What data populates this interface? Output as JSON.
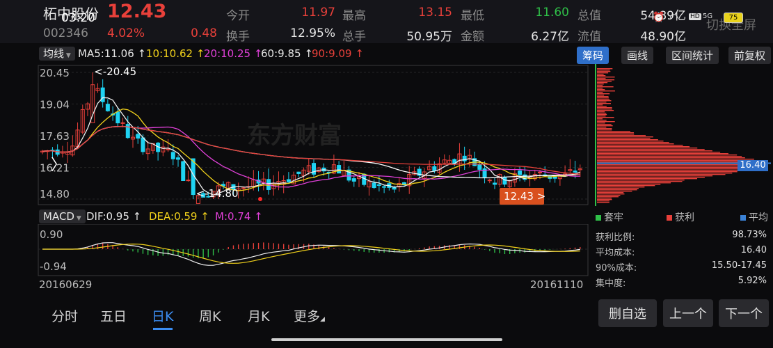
{
  "header": {
    "stock_name": "柘中股份",
    "price": "12.43",
    "time": "03:20",
    "code": "002346",
    "change_pct": "4.02%",
    "change_amt": "0.48",
    "fields": [
      {
        "label": "今开",
        "value": "11.97",
        "color": "red"
      },
      {
        "label": "最高",
        "value": "13.15",
        "color": "red"
      },
      {
        "label": "最低",
        "value": "11.60",
        "color": "green"
      },
      {
        "label": "总值",
        "value": "54.89亿",
        "color": "white"
      },
      {
        "label": "换手",
        "value": "12.95%",
        "color": "white"
      },
      {
        "label": "总手",
        "value": "50.95万",
        "color": "white"
      },
      {
        "label": "金额",
        "value": "6.27亿",
        "color": "white"
      },
      {
        "label": "流值",
        "value": "48.90亿",
        "color": "white"
      }
    ],
    "fullscreen_label": "切换全屏",
    "battery": "75",
    "status_5g": "5G"
  },
  "ma_bar": {
    "selector": "均线",
    "ma5": "MA5:11.06",
    "ma10": "10:10.62",
    "ma20": "20:10.25",
    "ma60": "60:9.85",
    "ma90": "90:9.09",
    "buttons": [
      "筹码",
      "画线",
      "区间统计",
      "前复权"
    ]
  },
  "macd_bar": {
    "selector": "MACD",
    "dif": "DIF:0.95",
    "dea": "DEA:0.59",
    "m": "M:0.74"
  },
  "chart_data": {
    "type": "candlestick",
    "y_ticks": [
      "20.45",
      "19.04",
      "17.63",
      "16.21",
      "14.80"
    ],
    "ylim": [
      14.8,
      20.45
    ],
    "max_marker": "<-20.45",
    "min_marker": "<-14.80",
    "current_price_tag": "12.43 >",
    "x_start": "20160629",
    "x_end": "20161110",
    "macd_ticks": [
      "0.90",
      "-0.94"
    ],
    "watermark": "东方财富",
    "colors": {
      "up": "#e8403a",
      "down": "#1fd3f2",
      "ma5": "#f0f0f0",
      "ma10": "#f2d21b",
      "ma20": "#e040d8",
      "ma60": "#ffffff",
      "ma90": "#e8403a"
    }
  },
  "chip_panel": {
    "avg_price_tag": "16.40",
    "legend": [
      {
        "label": "套牢",
        "color": "#2fbf48"
      },
      {
        "label": "获利",
        "color": "#e8403a"
      },
      {
        "label": "平均",
        "color": "#3b82d6"
      }
    ],
    "stats": [
      {
        "label": "获利比例:",
        "value": "98.73%"
      },
      {
        "label": "平均成本:",
        "value": "16.40"
      },
      {
        "label": "90%成本:",
        "value": "15.50-17.45"
      },
      {
        "label": "集中度:",
        "value": "5.92%"
      }
    ]
  },
  "bottom_tabs": [
    "分时",
    "五日",
    "日K",
    "周K",
    "月K",
    "更多"
  ],
  "active_tab": "日K",
  "side_buttons": [
    "删自选",
    "上一个",
    "下一个"
  ]
}
